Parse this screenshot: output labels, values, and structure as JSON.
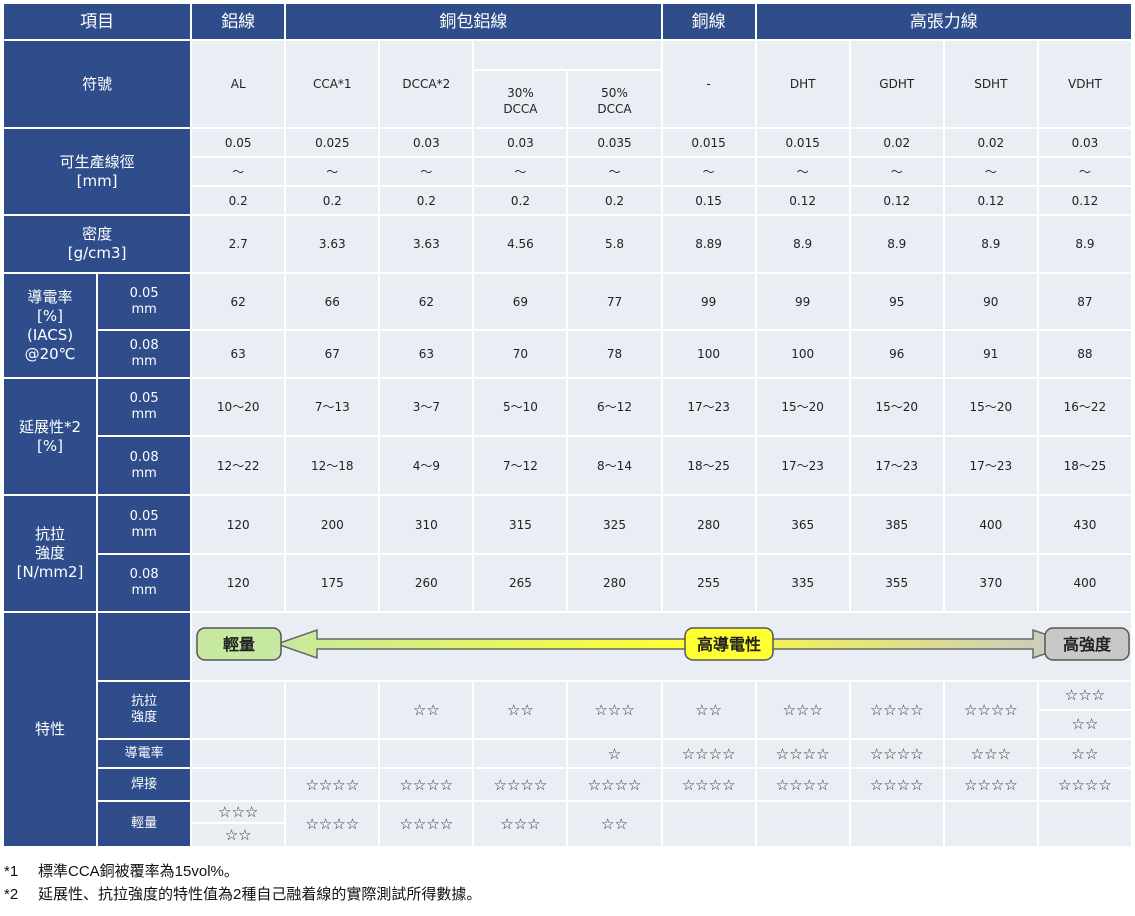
{
  "header": {
    "item": "項目",
    "al": "鋁線",
    "cca": "銅包鋁線",
    "cu": "銅線",
    "ht": "高張力線"
  },
  "symbol": {
    "label": "符號",
    "values": [
      "AL",
      "CCA*1",
      "DCCA*2",
      "30%\nDCCA",
      "50%\nDCCA",
      "-",
      "DHT",
      "GDHT",
      "SDHT",
      "VDHT"
    ]
  },
  "diameter": {
    "label": "可生產線徑\n[mm]",
    "min": [
      "0.05",
      "0.025",
      "0.03",
      "0.03",
      "0.035",
      "0.015",
      "0.015",
      "0.02",
      "0.02",
      "0.03"
    ],
    "tilde": "～",
    "max": [
      "0.2",
      "0.2",
      "0.2",
      "0.2",
      "0.2",
      "0.15",
      "0.12",
      "0.12",
      "0.12",
      "0.12"
    ]
  },
  "density": {
    "label": "密度\n[g/cm3]",
    "values": [
      "2.7",
      "3.63",
      "3.63",
      "4.56",
      "5.8",
      "8.89",
      "8.9",
      "8.9",
      "8.9",
      "8.9"
    ]
  },
  "conductivity": {
    "label": "導電率\n[%]\n(IACS)\n@20℃",
    "sub1": "0.05\nmm",
    "sub2": "0.08\nmm",
    "r1": [
      "62",
      "66",
      "62",
      "69",
      "77",
      "99",
      "99",
      "95",
      "90",
      "87"
    ],
    "r2": [
      "63",
      "67",
      "63",
      "70",
      "78",
      "100",
      "100",
      "96",
      "91",
      "88"
    ]
  },
  "elongation": {
    "label": "延展性*2\n[%]",
    "sub1": "0.05\nmm",
    "sub2": "0.08\nmm",
    "r1": [
      "10～20",
      "7～13",
      "3～7",
      "5～10",
      "6～12",
      "17～23",
      "15～20",
      "15～20",
      "15～20",
      "16～22"
    ],
    "r2": [
      "12～22",
      "12～18",
      "4～9",
      "7～12",
      "8～14",
      "18～25",
      "17～23",
      "17～23",
      "17～23",
      "18～25"
    ]
  },
  "tensile": {
    "label": "抗拉\n強度\n[N/mm2]",
    "sub1": "0.05\nmm",
    "sub2": "0.08\nmm",
    "r1": [
      "120",
      "200",
      "310",
      "315",
      "325",
      "280",
      "365",
      "385",
      "400",
      "430"
    ],
    "r2": [
      "120",
      "175",
      "260",
      "265",
      "280",
      "255",
      "335",
      "355",
      "370",
      "400"
    ]
  },
  "features": {
    "label": "特性",
    "arrow": {
      "left": "輕量",
      "mid": "高導電性",
      "right": "高強度"
    },
    "strength": {
      "label": "抗拉\n強度",
      "values": [
        "",
        "",
        "☆☆",
        "☆☆",
        "☆☆☆",
        "☆☆",
        "☆☆☆",
        "☆☆☆☆",
        "☆☆☆☆"
      ],
      "last_top": "☆☆☆",
      "last_bottom": "☆☆"
    },
    "conductivity": {
      "label": "導電率",
      "values": [
        "",
        "",
        "",
        "",
        "☆",
        "☆☆☆☆",
        "☆☆☆☆",
        "☆☆☆☆",
        "☆☆☆",
        "☆☆"
      ]
    },
    "welding": {
      "label": "焊接",
      "values": [
        "",
        "☆☆☆☆",
        "☆☆☆☆",
        "☆☆☆☆",
        "☆☆☆☆",
        "☆☆☆☆",
        "☆☆☆☆",
        "☆☆☆☆",
        "☆☆☆☆",
        "☆☆☆☆"
      ]
    },
    "light": {
      "label": "輕量",
      "first_top": "☆☆☆",
      "first_bottom": "☆☆",
      "values": [
        "☆☆☆☆",
        "☆☆☆☆",
        "☆☆☆",
        "☆☆",
        "",
        "",
        "",
        "",
        ""
      ]
    }
  },
  "notes": [
    {
      "key": "*1",
      "text": "標準CCA銅被覆率為15vol%。"
    },
    {
      "key": "*2",
      "text": "延展性、抗拉強度的特性值為2種自己融着線的實際測試所得數據。"
    }
  ],
  "colors": {
    "header": "#2f4d8a",
    "cell": "#e9edf4",
    "arrow_left": "#c6e8a0",
    "arrow_mid": "#ffff33",
    "arrow_right": "#c0c0c0"
  }
}
